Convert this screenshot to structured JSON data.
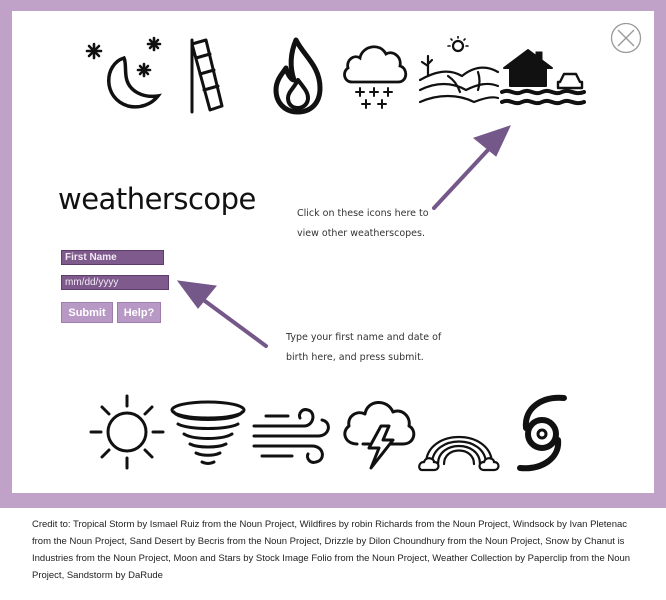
{
  "app": {
    "logo_text": "weatherscope",
    "accent_color": "#7e5b8c",
    "frame_color": "#c0a2c9"
  },
  "form": {
    "first_name_placeholder": "First Name",
    "dob_placeholder": "mm/dd/yyyy",
    "submit_label": "Submit",
    "help_label": "Help?"
  },
  "hints": {
    "icons_hint": "Click on these icons here to view other weatherscopes.",
    "form_hint": "Type your first name and date of birth here, and press submit."
  },
  "icons_top": [
    "moon-stars-icon",
    "windsock-icon",
    "wildfire-icon",
    "snow-cloud-icon",
    "sand-desert-icon",
    "flood-house-icon"
  ],
  "icons_bottom": [
    "sun-icon",
    "tornado-icon",
    "wind-icon",
    "thunderstorm-icon",
    "rainbow-icon",
    "tropical-storm-icon"
  ],
  "close_icon": "close-icon",
  "credits": "Credit to: Tropical Storm by Ismael Ruiz from the Noun Project, Wildfires by robin Richards from the Noun Project, Windsock by Ivan Pletenac from the Noun Project, Sand Desert by Becris from the Noun Project, Drizzle by Dilon Choundhury from the Noun Project, Snow by Chanut is Industries from the Noun Project, Moon and Stars by Stock Image Folio from the Noun Project, Weather Collection by Paperclip from the Noun Project, Sandstorm by DaRude"
}
